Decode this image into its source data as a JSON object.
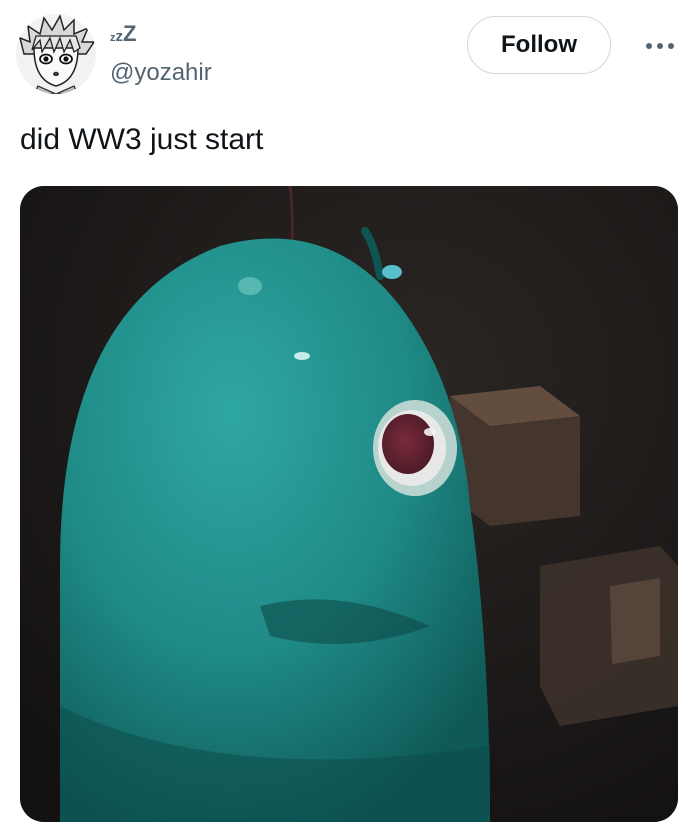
{
  "author": {
    "display_name_glyphs": [
      "z",
      "z",
      "Z"
    ],
    "handle": "@yozahir",
    "avatar_icon": "anime-avatar"
  },
  "actions": {
    "follow_label": "Follow",
    "more_icon": "more-horizontal-icon"
  },
  "tweet": {
    "text": "did WW3 just start"
  },
  "media": {
    "type": "photo",
    "subject": "blue-blob-character-photo"
  },
  "colors": {
    "text_primary": "#0f1419",
    "text_secondary": "#536471",
    "button_border": "#cfd9de",
    "blob": "#1f8a86"
  }
}
